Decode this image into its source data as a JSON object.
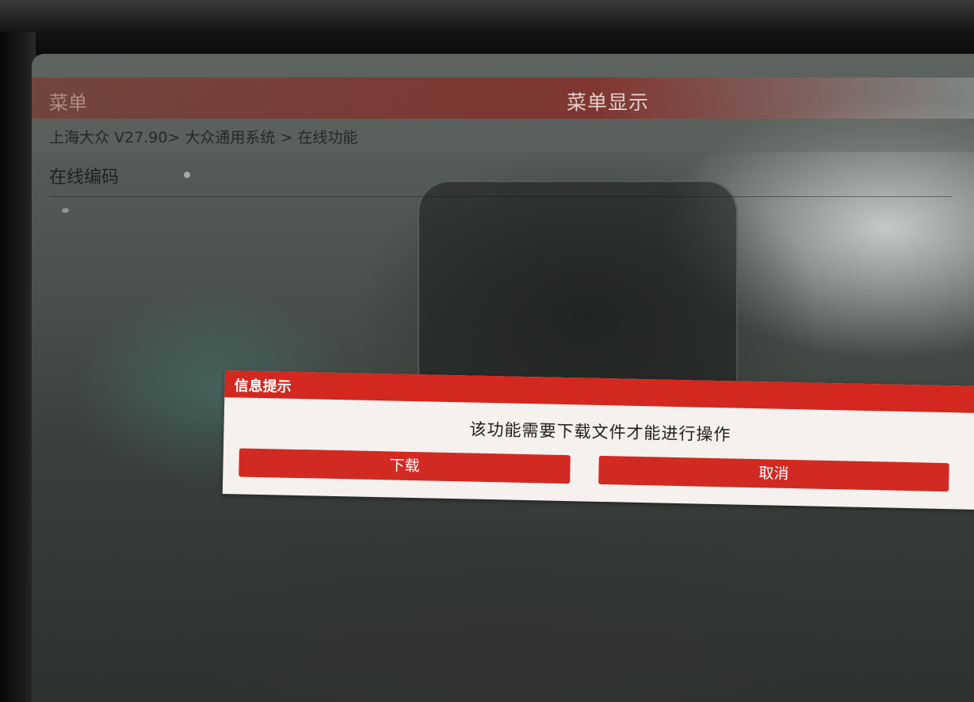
{
  "header": {
    "left_label": "菜单",
    "title": "菜单显示"
  },
  "breadcrumb": "上海大众 V27.90> 大众通用系统 > 在线功能",
  "menu": {
    "items": [
      {
        "label": "在线编码"
      }
    ]
  },
  "dialog": {
    "title": "信息提示",
    "message": "该功能需要下载文件才能进行操作",
    "download_label": "下载",
    "cancel_label": "取消"
  },
  "colors": {
    "accent_red": "#d3281f",
    "dialog_background": "#f4f1ee"
  }
}
